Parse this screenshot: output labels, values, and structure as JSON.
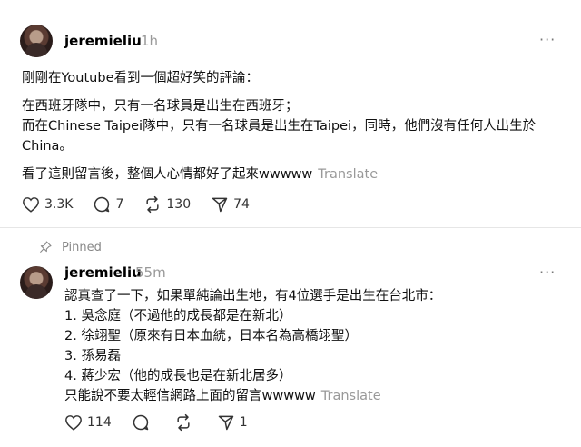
{
  "post1": {
    "username": "jeremieliu",
    "time": "1h",
    "more": "···",
    "lines": [
      "剛剛在Youtube看到一個超好笑的評論：",
      "在西班牙隊中，只有一名球員是出生在西班牙；",
      "而在Chinese Taipei隊中，只有一名球員是出生在Taipei，同時，他們沒有任何人出生於",
      "China。",
      "看了這則留言後，整個人心情都好了起來wwwww"
    ],
    "translate": "Translate",
    "likes": "3.3K",
    "replies": "7",
    "reposts": "130",
    "shares": "74"
  },
  "post2": {
    "pinned_label": "Pinned",
    "username": "jeremieliu",
    "time": "55m",
    "more": "···",
    "lines": [
      "認真查了一下，如果單純論出生地，有4位選手是出生在台北市：",
      "1. 吳念庭（不過他的成長都是在新北）",
      "2. 徐翊聖（原來有日本血統，日本名為高橋翊聖）",
      "3. 孫易磊",
      "4. 蔣少宏（他的成長也是在新北居多）",
      "只能說不要太輕信網路上面的留言wwwww"
    ],
    "translate": "Translate",
    "likes": "114",
    "shares": "1"
  }
}
